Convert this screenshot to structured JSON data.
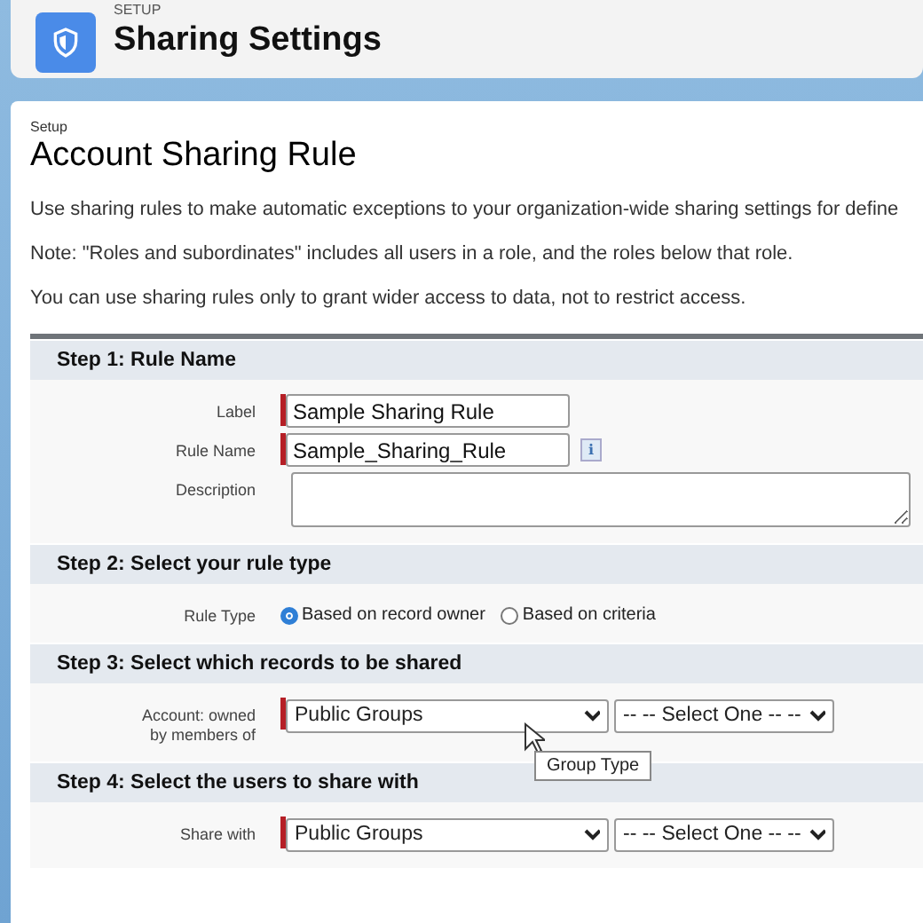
{
  "header": {
    "eyebrow": "SETUP",
    "title": "Sharing Settings"
  },
  "page": {
    "breadcrumb": "Setup",
    "title": "Account Sharing Rule",
    "paragraphs": [
      "Use sharing rules to make automatic exceptions to your organization-wide sharing settings for define",
      "Note: \"Roles and subordinates\" includes all users in a role, and the roles below that role.",
      "You can use sharing rules only to grant wider access to data, not to restrict access."
    ]
  },
  "steps": [
    {
      "title": "Step 1: Rule Name",
      "fields": [
        {
          "kind": "text",
          "label": "Label",
          "value": "Sample Sharing Rule",
          "required": true
        },
        {
          "kind": "text",
          "label": "Rule Name",
          "value": "Sample_Sharing_Rule",
          "required": true,
          "info": "i"
        },
        {
          "kind": "textarea",
          "label": "Description",
          "required": false
        }
      ]
    },
    {
      "title": "Step 2: Select your rule type",
      "fields": [
        {
          "kind": "radio",
          "label": "Rule Type",
          "options": [
            {
              "label": "Based on record owner",
              "selected": true
            },
            {
              "label": "Based on criteria",
              "selected": false
            }
          ]
        }
      ]
    },
    {
      "title": "Step 3: Select which records to be shared",
      "fields": [
        {
          "kind": "selects",
          "label": "Account: owned by members of",
          "required": true,
          "selects": [
            {
              "value": "Public Groups",
              "tooltip": "Group Type"
            },
            {
              "value": "-- -- Select One -- --"
            }
          ]
        }
      ]
    },
    {
      "title": "Step 4: Select the users to share with",
      "fields": [
        {
          "kind": "selects",
          "label": "Share with",
          "required": true,
          "selects": [
            {
              "value": "Public Groups"
            },
            {
              "value": "-- -- Select One -- --"
            }
          ]
        }
      ]
    }
  ]
}
